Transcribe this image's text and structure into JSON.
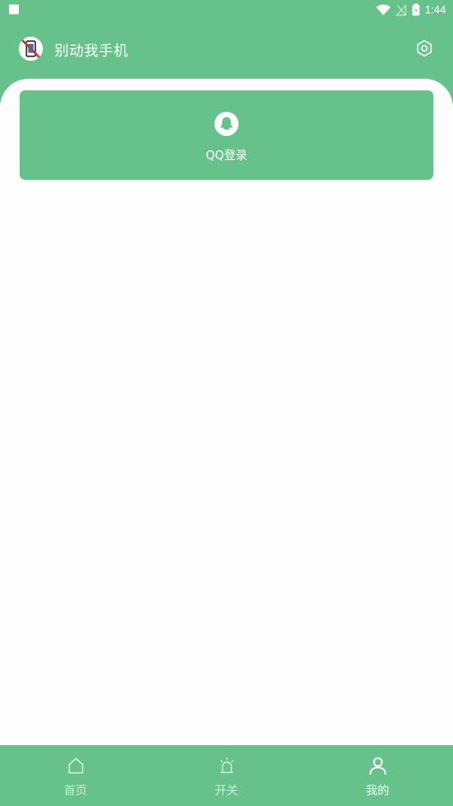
{
  "status_bar": {
    "time": "1:44"
  },
  "header": {
    "title": "别动我手机"
  },
  "login": {
    "label": "QQ登录"
  },
  "nav": [
    {
      "label": "首页",
      "icon": "home-icon",
      "active": false
    },
    {
      "label": "开关",
      "icon": "alarm-light-icon",
      "active": false
    },
    {
      "label": "我的",
      "icon": "user-icon",
      "active": true
    }
  ],
  "colors": {
    "primary": "#66c28a",
    "background": "#fdfdfd"
  }
}
